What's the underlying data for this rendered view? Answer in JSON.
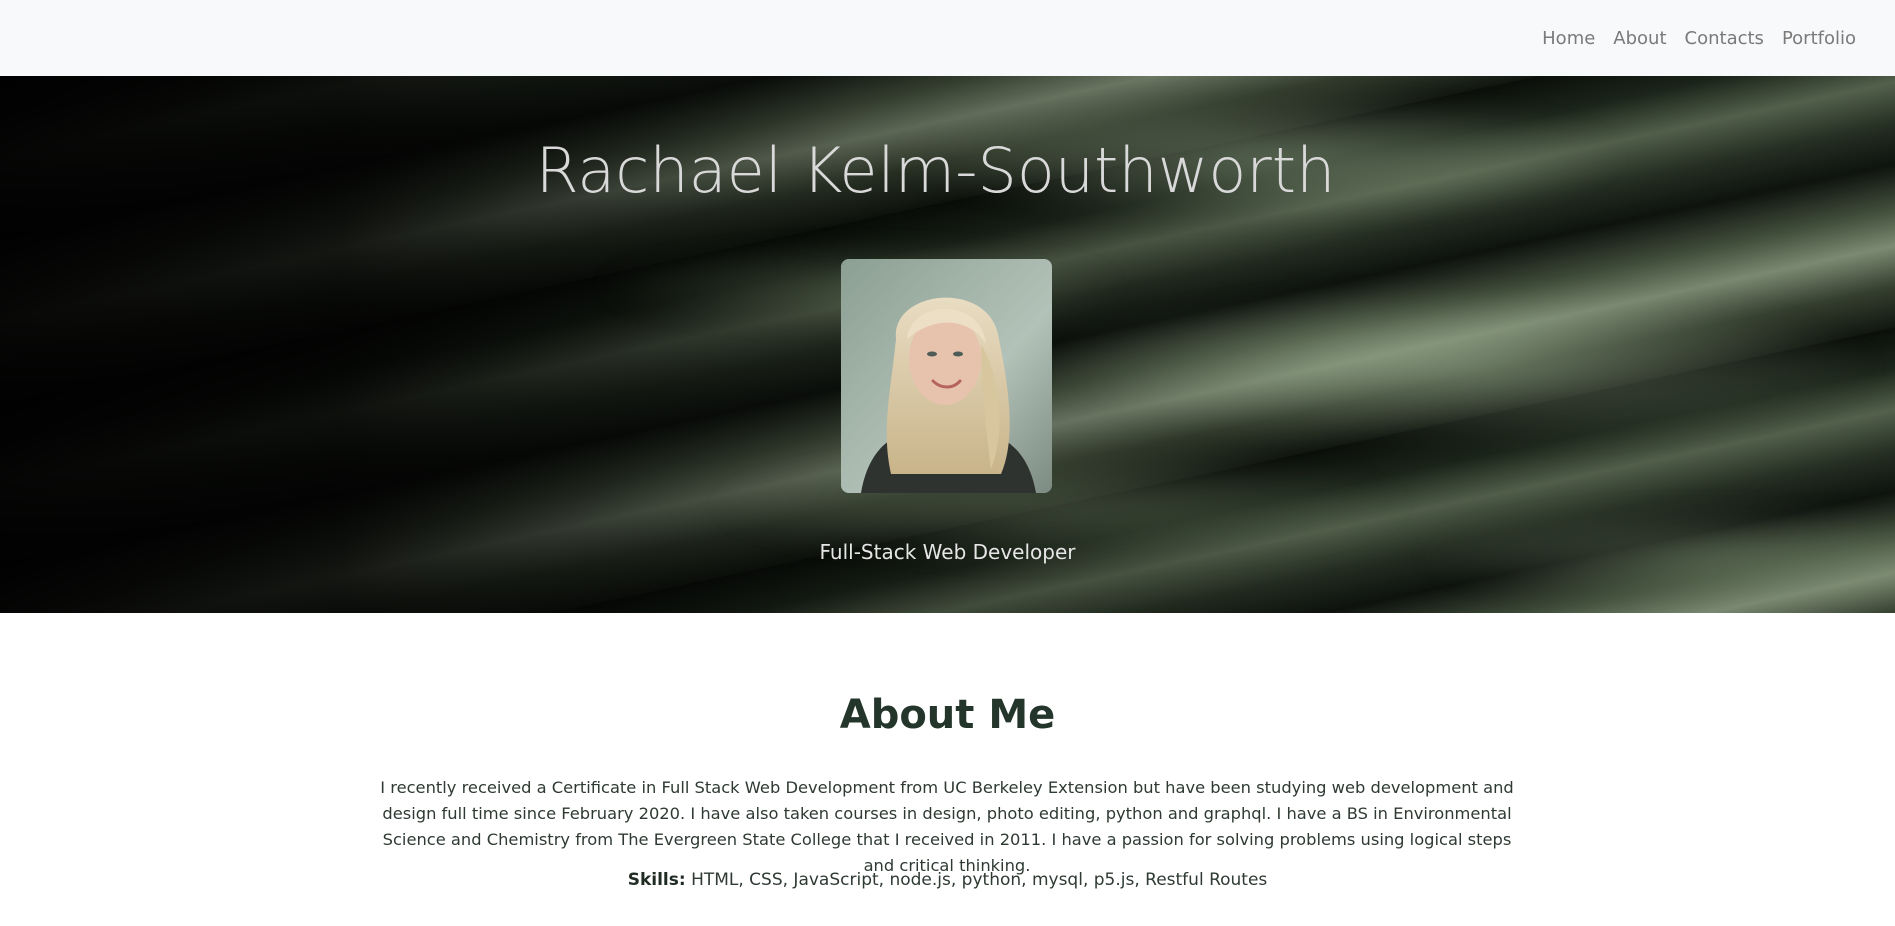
{
  "nav": {
    "items": [
      {
        "label": "Home"
      },
      {
        "label": "About"
      },
      {
        "label": "Contacts"
      },
      {
        "label": "Portfolio"
      }
    ]
  },
  "hero": {
    "name": "Rachael Kelm-Southworth",
    "role": "Full-Stack Web Developer"
  },
  "about": {
    "title": "About Me",
    "paragraph": "I recently received a Certificate in Full Stack Web Development from UC Berkeley Extension but have been studying web development and design full time since February 2020. I have also taken courses in design, photo editing, python and graphql. I have a BS in Environmental Science and Chemistry from The Evergreen State College that I received in 2011. I have a passion for solving problems using logical steps and critical thinking.",
    "skills_label": "Skills:",
    "skills_value": "HTML, CSS, JavaScript, node.js, python, mysql, p5.js, Restful Routes"
  },
  "colors": {
    "navbar_bg": "#f8f9fa",
    "nav_link": "#7a7a7a",
    "heading": "#24362b",
    "hero_text": "#d9d9d9"
  }
}
